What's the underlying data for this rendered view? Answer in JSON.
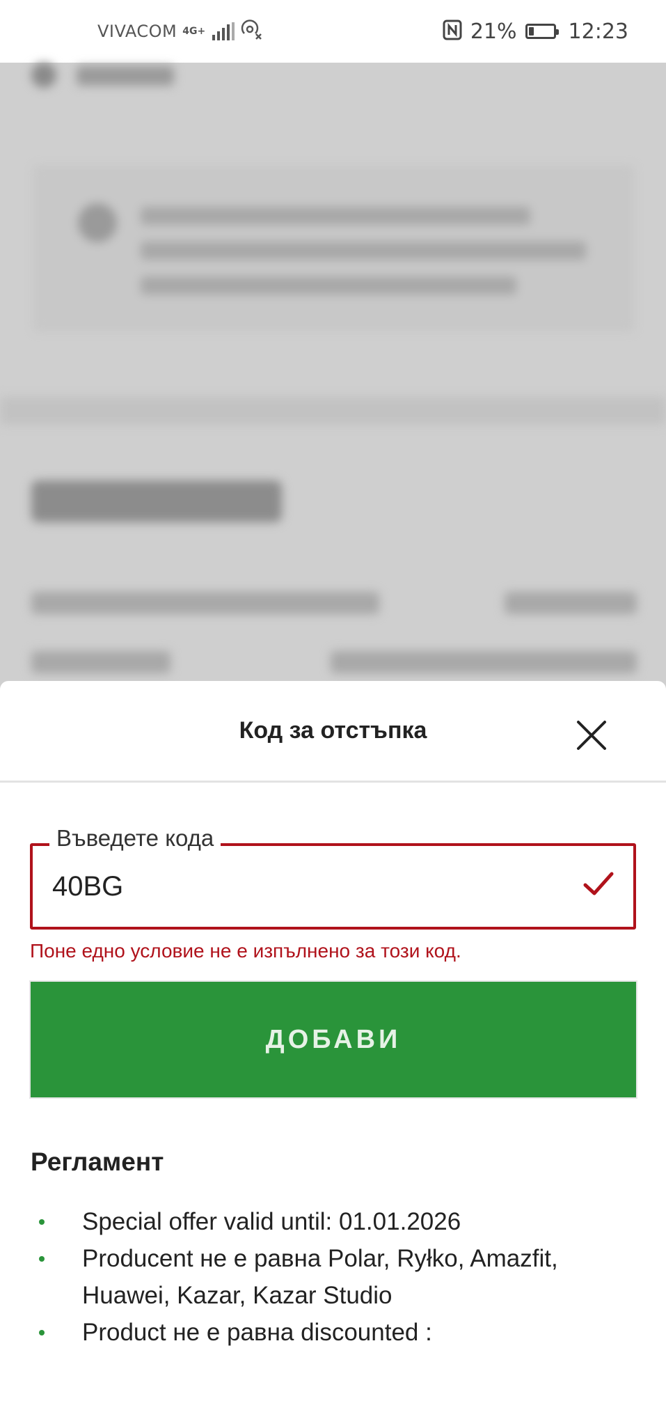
{
  "status_bar": {
    "carrier": "VIVACOM",
    "network": "4G+",
    "battery": "21%",
    "battery_level": 0.21,
    "time": "12:23"
  },
  "sheet": {
    "title": "Код за отстъпка",
    "close_icon": "close-icon",
    "code_field": {
      "label": "Въведете кода",
      "value": "40BG"
    },
    "error": "Поне едно условие не е изпълнено за този код.",
    "add_button": "ДОБАВИ",
    "rules": {
      "heading": "Регламент",
      "items": [
        "Special offer valid until: 01.01.2026",
        "Producent не е равна Polar, Ryłko, Amazfit, Huawei, Kazar, Kazar Studio",
        "Product не е равна discounted :"
      ]
    }
  },
  "colors": {
    "error": "#b0121b",
    "primary_button": "#2a943a",
    "overlay": "#cfcfcf"
  }
}
